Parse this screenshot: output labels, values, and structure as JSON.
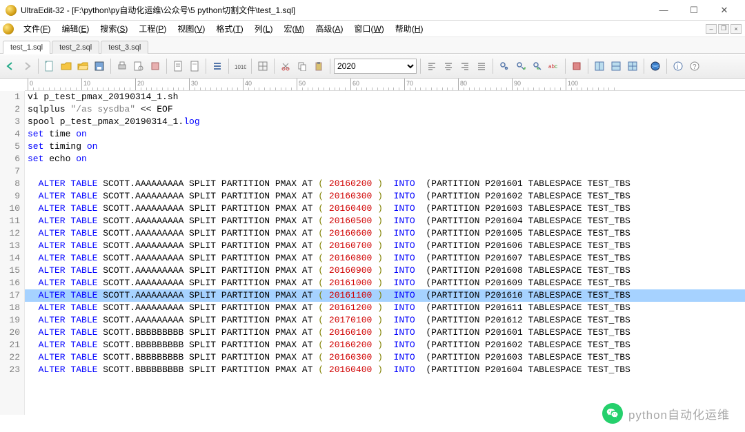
{
  "title": "UltraEdit-32 - [F:\\python\\py自动化运维\\公众号\\5 python切割文件\\test_1.sql]",
  "menu": [
    "文件(F)",
    "编辑(E)",
    "搜索(S)",
    "工程(P)",
    "视图(V)",
    "格式(T)",
    "列(L)",
    "宏(M)",
    "高级(A)",
    "窗口(W)",
    "帮助(H)"
  ],
  "menu_keys": [
    "F",
    "E",
    "S",
    "P",
    "V",
    "T",
    "L",
    "M",
    "A",
    "W",
    "H"
  ],
  "doc_tabs": [
    "test_1.sql",
    "test_2.sql",
    "test_3.sql"
  ],
  "active_tab": 0,
  "toolbar": {
    "combo_value": "2020"
  },
  "ruler_marks": [
    0,
    10,
    20,
    30,
    40,
    50,
    60,
    70,
    80,
    90,
    100
  ],
  "highlight_line": 17,
  "lines": [
    {
      "n": 1,
      "segs": [
        {
          "t": "vi p_test_pmax_20190314_1.sh",
          "c": "kw-black"
        }
      ]
    },
    {
      "n": 2,
      "segs": [
        {
          "t": "sqlplus ",
          "c": "kw-black"
        },
        {
          "t": "\"/as sysdba\"",
          "c": "kw-gray"
        },
        {
          "t": " << EOF",
          "c": "kw-black"
        }
      ]
    },
    {
      "n": 3,
      "segs": [
        {
          "t": "spool p_test_pmax_20190314_1.",
          "c": "kw-black"
        },
        {
          "t": "log",
          "c": "kw-blue"
        }
      ]
    },
    {
      "n": 4,
      "segs": [
        {
          "t": "set",
          "c": "kw-blue"
        },
        {
          "t": " time ",
          "c": "kw-black"
        },
        {
          "t": "on",
          "c": "kw-blue"
        }
      ]
    },
    {
      "n": 5,
      "segs": [
        {
          "t": "set",
          "c": "kw-blue"
        },
        {
          "t": " timing ",
          "c": "kw-black"
        },
        {
          "t": "on",
          "c": "kw-blue"
        }
      ]
    },
    {
      "n": 6,
      "segs": [
        {
          "t": "set",
          "c": "kw-blue"
        },
        {
          "t": " echo ",
          "c": "kw-black"
        },
        {
          "t": "on",
          "c": "kw-blue"
        }
      ]
    },
    {
      "n": 7,
      "segs": [
        {
          "t": " ",
          "c": "kw-black"
        }
      ]
    },
    {
      "n": 8,
      "segs": [
        {
          "t": "  ALTER TABLE",
          "c": "kw-blue"
        },
        {
          "t": " SCOTT.AAAAAAAAA SPLIT PARTITION PMAX AT ",
          "c": "kw-black"
        },
        {
          "t": "(",
          "c": "kw-brown"
        },
        {
          "t": " 20160200 ",
          "c": "kw-red"
        },
        {
          "t": ")",
          "c": "kw-brown"
        },
        {
          "t": "  ",
          "c": "kw-black"
        },
        {
          "t": "INTO",
          "c": "kw-blue"
        },
        {
          "t": "  (PARTITION P201601 TABLESPACE TEST_TBS",
          "c": "kw-black"
        }
      ]
    },
    {
      "n": 9,
      "segs": [
        {
          "t": "  ALTER TABLE",
          "c": "kw-blue"
        },
        {
          "t": " SCOTT.AAAAAAAAA SPLIT PARTITION PMAX AT ",
          "c": "kw-black"
        },
        {
          "t": "(",
          "c": "kw-brown"
        },
        {
          "t": " 20160300 ",
          "c": "kw-red"
        },
        {
          "t": ")",
          "c": "kw-brown"
        },
        {
          "t": "  ",
          "c": "kw-black"
        },
        {
          "t": "INTO",
          "c": "kw-blue"
        },
        {
          "t": "  (PARTITION P201602 TABLESPACE TEST_TBS",
          "c": "kw-black"
        }
      ]
    },
    {
      "n": 10,
      "segs": [
        {
          "t": "  ALTER TABLE",
          "c": "kw-blue"
        },
        {
          "t": " SCOTT.AAAAAAAAA SPLIT PARTITION PMAX AT ",
          "c": "kw-black"
        },
        {
          "t": "(",
          "c": "kw-brown"
        },
        {
          "t": " 20160400 ",
          "c": "kw-red"
        },
        {
          "t": ")",
          "c": "kw-brown"
        },
        {
          "t": "  ",
          "c": "kw-black"
        },
        {
          "t": "INTO",
          "c": "kw-blue"
        },
        {
          "t": "  (PARTITION P201603 TABLESPACE TEST_TBS",
          "c": "kw-black"
        }
      ]
    },
    {
      "n": 11,
      "segs": [
        {
          "t": "  ALTER TABLE",
          "c": "kw-blue"
        },
        {
          "t": " SCOTT.AAAAAAAAA SPLIT PARTITION PMAX AT ",
          "c": "kw-black"
        },
        {
          "t": "(",
          "c": "kw-brown"
        },
        {
          "t": " 20160500 ",
          "c": "kw-red"
        },
        {
          "t": ")",
          "c": "kw-brown"
        },
        {
          "t": "  ",
          "c": "kw-black"
        },
        {
          "t": "INTO",
          "c": "kw-blue"
        },
        {
          "t": "  (PARTITION P201604 TABLESPACE TEST_TBS",
          "c": "kw-black"
        }
      ]
    },
    {
      "n": 12,
      "segs": [
        {
          "t": "  ALTER TABLE",
          "c": "kw-blue"
        },
        {
          "t": " SCOTT.AAAAAAAAA SPLIT PARTITION PMAX AT ",
          "c": "kw-black"
        },
        {
          "t": "(",
          "c": "kw-brown"
        },
        {
          "t": " 20160600 ",
          "c": "kw-red"
        },
        {
          "t": ")",
          "c": "kw-brown"
        },
        {
          "t": "  ",
          "c": "kw-black"
        },
        {
          "t": "INTO",
          "c": "kw-blue"
        },
        {
          "t": "  (PARTITION P201605 TABLESPACE TEST_TBS",
          "c": "kw-black"
        }
      ]
    },
    {
      "n": 13,
      "segs": [
        {
          "t": "  ALTER TABLE",
          "c": "kw-blue"
        },
        {
          "t": " SCOTT.AAAAAAAAA SPLIT PARTITION PMAX AT ",
          "c": "kw-black"
        },
        {
          "t": "(",
          "c": "kw-brown"
        },
        {
          "t": " 20160700 ",
          "c": "kw-red"
        },
        {
          "t": ")",
          "c": "kw-brown"
        },
        {
          "t": "  ",
          "c": "kw-black"
        },
        {
          "t": "INTO",
          "c": "kw-blue"
        },
        {
          "t": "  (PARTITION P201606 TABLESPACE TEST_TBS",
          "c": "kw-black"
        }
      ]
    },
    {
      "n": 14,
      "segs": [
        {
          "t": "  ALTER TABLE",
          "c": "kw-blue"
        },
        {
          "t": " SCOTT.AAAAAAAAA SPLIT PARTITION PMAX AT ",
          "c": "kw-black"
        },
        {
          "t": "(",
          "c": "kw-brown"
        },
        {
          "t": " 20160800 ",
          "c": "kw-red"
        },
        {
          "t": ")",
          "c": "kw-brown"
        },
        {
          "t": "  ",
          "c": "kw-black"
        },
        {
          "t": "INTO",
          "c": "kw-blue"
        },
        {
          "t": "  (PARTITION P201607 TABLESPACE TEST_TBS",
          "c": "kw-black"
        }
      ]
    },
    {
      "n": 15,
      "segs": [
        {
          "t": "  ALTER TABLE",
          "c": "kw-blue"
        },
        {
          "t": " SCOTT.AAAAAAAAA SPLIT PARTITION PMAX AT ",
          "c": "kw-black"
        },
        {
          "t": "(",
          "c": "kw-brown"
        },
        {
          "t": " 20160900 ",
          "c": "kw-red"
        },
        {
          "t": ")",
          "c": "kw-brown"
        },
        {
          "t": "  ",
          "c": "kw-black"
        },
        {
          "t": "INTO",
          "c": "kw-blue"
        },
        {
          "t": "  (PARTITION P201608 TABLESPACE TEST_TBS",
          "c": "kw-black"
        }
      ]
    },
    {
      "n": 16,
      "segs": [
        {
          "t": "  ALTER TABLE",
          "c": "kw-blue"
        },
        {
          "t": " SCOTT.AAAAAAAAA SPLIT PARTITION PMAX AT ",
          "c": "kw-black"
        },
        {
          "t": "(",
          "c": "kw-brown"
        },
        {
          "t": " 20161000 ",
          "c": "kw-red"
        },
        {
          "t": ")",
          "c": "kw-brown"
        },
        {
          "t": "  ",
          "c": "kw-black"
        },
        {
          "t": "INTO",
          "c": "kw-blue"
        },
        {
          "t": "  (PARTITION P201609 TABLESPACE TEST_TBS",
          "c": "kw-black"
        }
      ]
    },
    {
      "n": 17,
      "segs": [
        {
          "t": "  ALTER TABLE",
          "c": "kw-blue"
        },
        {
          "t": " SCOTT.AAAAAAAAA SPLIT PARTITION PMAX AT ",
          "c": "kw-black"
        },
        {
          "t": "(",
          "c": "kw-brown"
        },
        {
          "t": " 20161100 ",
          "c": "kw-red"
        },
        {
          "t": ")",
          "c": "kw-brown"
        },
        {
          "t": "  ",
          "c": "kw-black"
        },
        {
          "t": "INTO",
          "c": "kw-blue"
        },
        {
          "t": "  (PARTITION P201610 TABLESPACE TEST_TBS",
          "c": "kw-black"
        }
      ]
    },
    {
      "n": 18,
      "segs": [
        {
          "t": "  ALTER TABLE",
          "c": "kw-blue"
        },
        {
          "t": " SCOTT.AAAAAAAAA SPLIT PARTITION PMAX AT ",
          "c": "kw-black"
        },
        {
          "t": "(",
          "c": "kw-brown"
        },
        {
          "t": " 20161200 ",
          "c": "kw-red"
        },
        {
          "t": ")",
          "c": "kw-brown"
        },
        {
          "t": "  ",
          "c": "kw-black"
        },
        {
          "t": "INTO",
          "c": "kw-blue"
        },
        {
          "t": "  (PARTITION P201611 TABLESPACE TEST_TBS",
          "c": "kw-black"
        }
      ]
    },
    {
      "n": 19,
      "segs": [
        {
          "t": "  ALTER TABLE",
          "c": "kw-blue"
        },
        {
          "t": " SCOTT.AAAAAAAAA SPLIT PARTITION PMAX AT ",
          "c": "kw-black"
        },
        {
          "t": "(",
          "c": "kw-brown"
        },
        {
          "t": " 20170100 ",
          "c": "kw-red"
        },
        {
          "t": ")",
          "c": "kw-brown"
        },
        {
          "t": "  ",
          "c": "kw-black"
        },
        {
          "t": "INTO",
          "c": "kw-blue"
        },
        {
          "t": "  (PARTITION P201612 TABLESPACE TEST_TBS",
          "c": "kw-black"
        }
      ]
    },
    {
      "n": 20,
      "segs": [
        {
          "t": "  ALTER TABLE",
          "c": "kw-blue"
        },
        {
          "t": " SCOTT.BBBBBBBBB SPLIT PARTITION PMAX AT ",
          "c": "kw-black"
        },
        {
          "t": "(",
          "c": "kw-brown"
        },
        {
          "t": " 20160100 ",
          "c": "kw-red"
        },
        {
          "t": ")",
          "c": "kw-brown"
        },
        {
          "t": "  ",
          "c": "kw-black"
        },
        {
          "t": "INTO",
          "c": "kw-blue"
        },
        {
          "t": "  (PARTITION P201601 TABLESPACE TEST_TBS",
          "c": "kw-black"
        }
      ]
    },
    {
      "n": 21,
      "segs": [
        {
          "t": "  ALTER TABLE",
          "c": "kw-blue"
        },
        {
          "t": " SCOTT.BBBBBBBBB SPLIT PARTITION PMAX AT ",
          "c": "kw-black"
        },
        {
          "t": "(",
          "c": "kw-brown"
        },
        {
          "t": " 20160200 ",
          "c": "kw-red"
        },
        {
          "t": ")",
          "c": "kw-brown"
        },
        {
          "t": "  ",
          "c": "kw-black"
        },
        {
          "t": "INTO",
          "c": "kw-blue"
        },
        {
          "t": "  (PARTITION P201602 TABLESPACE TEST_TBS",
          "c": "kw-black"
        }
      ]
    },
    {
      "n": 22,
      "segs": [
        {
          "t": "  ALTER TABLE",
          "c": "kw-blue"
        },
        {
          "t": " SCOTT.BBBBBBBBB SPLIT PARTITION PMAX AT ",
          "c": "kw-black"
        },
        {
          "t": "(",
          "c": "kw-brown"
        },
        {
          "t": " 20160300 ",
          "c": "kw-red"
        },
        {
          "t": ")",
          "c": "kw-brown"
        },
        {
          "t": "  ",
          "c": "kw-black"
        },
        {
          "t": "INTO",
          "c": "kw-blue"
        },
        {
          "t": "  (PARTITION P201603 TABLESPACE TEST_TBS",
          "c": "kw-black"
        }
      ]
    },
    {
      "n": 23,
      "segs": [
        {
          "t": "  ALTER TABLE",
          "c": "kw-blue"
        },
        {
          "t": " SCOTT.BBBBBBBBB SPLIT PARTITION PMAX AT ",
          "c": "kw-black"
        },
        {
          "t": "(",
          "c": "kw-brown"
        },
        {
          "t": " 20160400 ",
          "c": "kw-red"
        },
        {
          "t": ")",
          "c": "kw-brown"
        },
        {
          "t": "  ",
          "c": "kw-black"
        },
        {
          "t": "INTO",
          "c": "kw-blue"
        },
        {
          "t": "  (PARTITION P201604 TABLESPACE TEST_TBS",
          "c": "kw-black"
        }
      ]
    }
  ],
  "watermark": "python自动化运维"
}
